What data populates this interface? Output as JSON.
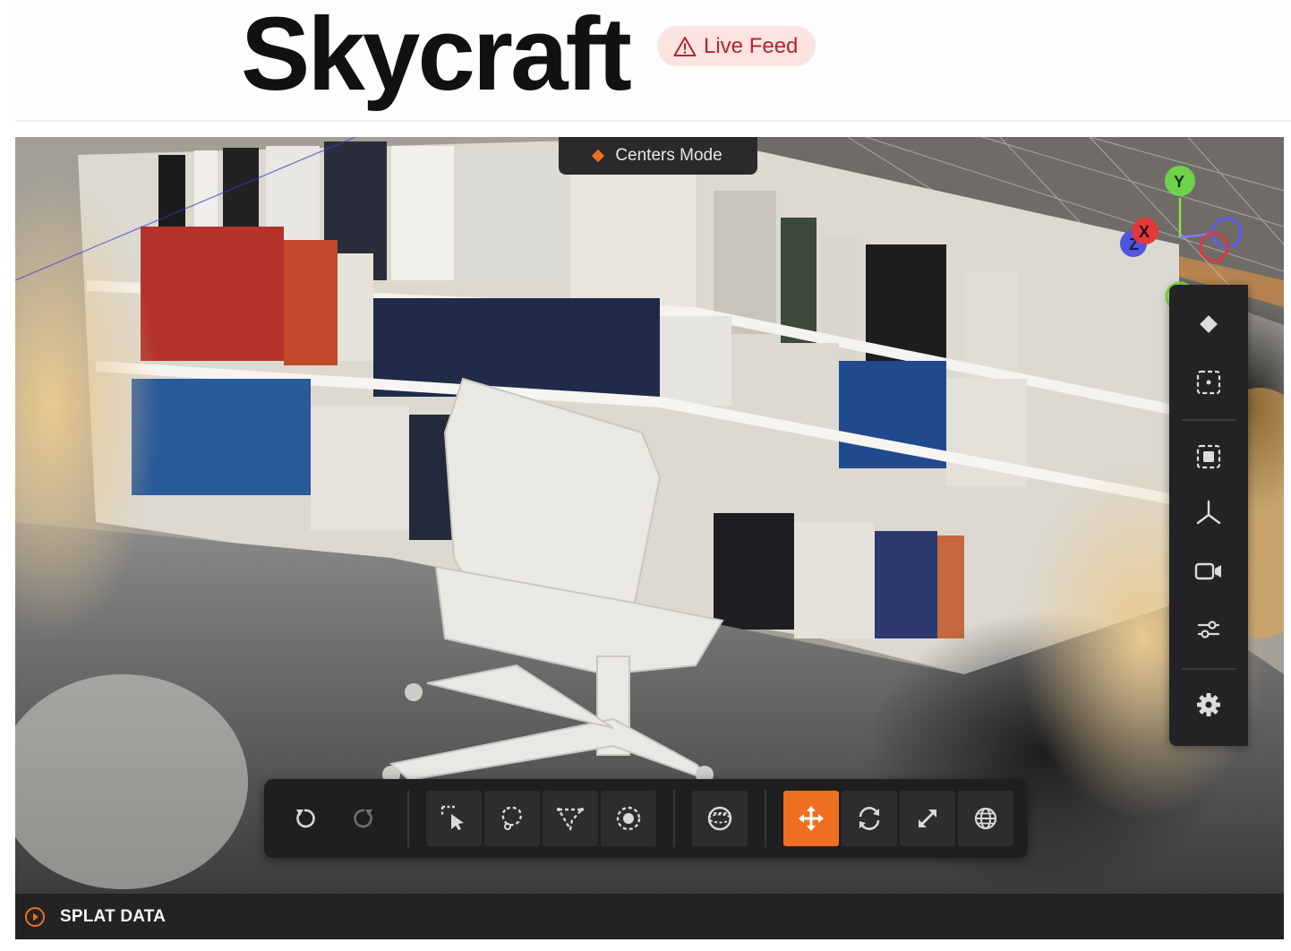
{
  "header": {
    "title": "Skycraft",
    "badge": "Live Feed"
  },
  "viewport": {
    "mode_label": "Centers Mode",
    "gizmo": {
      "x": "X",
      "y": "Y",
      "z": "Z"
    }
  },
  "right_panel": {
    "items": [
      {
        "name": "splat-diamond-icon"
      },
      {
        "name": "frame-selection-icon"
      },
      {
        "name": "focus-selection-icon"
      },
      {
        "name": "axes-icon"
      },
      {
        "name": "camera-icon"
      },
      {
        "name": "sliders-icon"
      },
      {
        "name": "gear-icon"
      }
    ]
  },
  "toolbar": {
    "tools": [
      {
        "name": "undo-icon"
      },
      {
        "name": "redo-icon"
      },
      {
        "name": "rect-select-icon"
      },
      {
        "name": "lasso-select-icon"
      },
      {
        "name": "polygon-select-icon"
      },
      {
        "name": "brush-select-icon"
      },
      {
        "name": "sphere-select-icon"
      },
      {
        "name": "move-icon",
        "active": true
      },
      {
        "name": "rotate-icon"
      },
      {
        "name": "scale-icon"
      },
      {
        "name": "world-space-icon"
      }
    ],
    "accent": "#f06e22"
  },
  "bottom_bar": {
    "label": "SPLAT DATA"
  }
}
